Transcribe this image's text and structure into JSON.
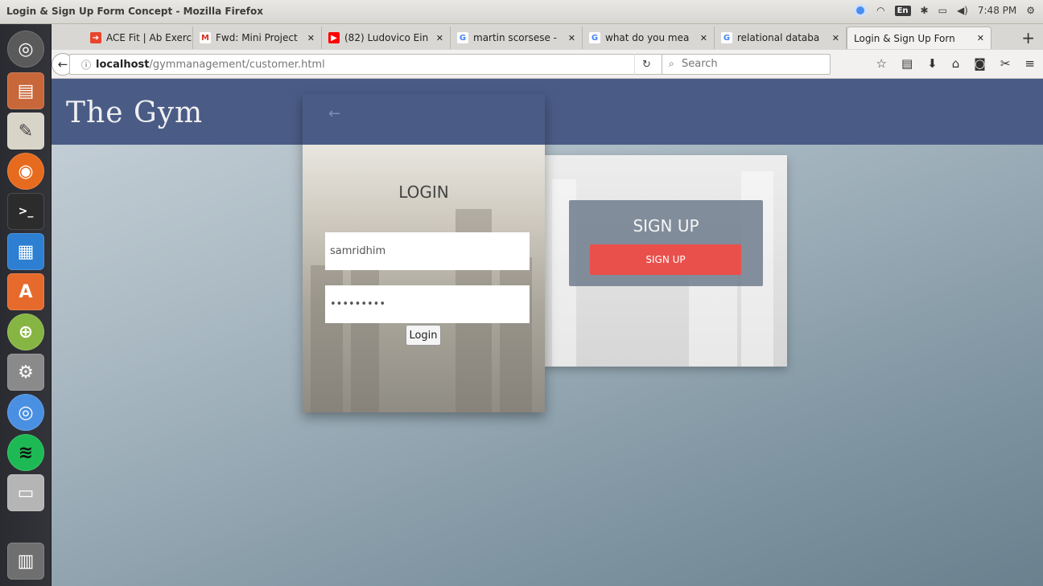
{
  "window": {
    "title": "Login & Sign Up Form Concept - Mozilla Firefox"
  },
  "indicators": {
    "lang": "En",
    "time": "7:48 PM"
  },
  "tabs": [
    {
      "label": "ACE Fit | Ab Exerc",
      "favicon_color": "#e8452c"
    },
    {
      "label": "Fwd: Mini Project",
      "favicon_color": "#d93025"
    },
    {
      "label": "(82) Ludovico Ein",
      "favicon_color": "#ff0000"
    },
    {
      "label": "martin scorsese -",
      "favicon_color": "#4285f4"
    },
    {
      "label": "what do you mea",
      "favicon_color": "#4285f4"
    },
    {
      "label": "relational databa",
      "favicon_color": "#4285f4"
    },
    {
      "label": "Login & Sign Up Forn",
      "favicon_color": ""
    }
  ],
  "url": {
    "host": "localhost",
    "path": "/gymmanagement/customer.html"
  },
  "search": {
    "placeholder": "Search"
  },
  "site": {
    "title": "The Gym"
  },
  "login": {
    "heading": "LOGIN",
    "username": "samridhim",
    "password": "password1",
    "button": "Login"
  },
  "signup": {
    "heading": "SIGN UP",
    "button": "SIGN UP",
    "button_color": "#e9504c"
  },
  "colors": {
    "header": "#4a5c86"
  }
}
